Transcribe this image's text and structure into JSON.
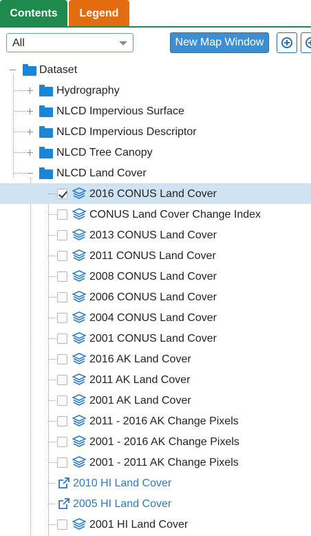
{
  "tabs": {
    "contents": "Contents",
    "legend": "Legend"
  },
  "toolbar": {
    "filter_value": "All",
    "new_map_window": "New Map Window"
  },
  "tree": {
    "root": "Dataset",
    "folders": [
      {
        "label": "Hydrography",
        "state": "collapsed"
      },
      {
        "label": "NLCD Impervious Surface",
        "state": "collapsed"
      },
      {
        "label": "NLCD Impervious Descriptor",
        "state": "collapsed"
      },
      {
        "label": "NLCD Tree Canopy",
        "state": "collapsed"
      },
      {
        "label": "NLCD Land Cover",
        "state": "expanded"
      }
    ],
    "land_cover_items": [
      {
        "label": "2016 CONUS Land Cover",
        "type": "layer",
        "checked": true,
        "selected": true
      },
      {
        "label": "CONUS Land Cover Change Index",
        "type": "layer",
        "checked": false
      },
      {
        "label": "2013 CONUS Land Cover",
        "type": "layer",
        "checked": false
      },
      {
        "label": "2011 CONUS Land Cover",
        "type": "layer",
        "checked": false
      },
      {
        "label": "2008 CONUS Land Cover",
        "type": "layer",
        "checked": false
      },
      {
        "label": "2006 CONUS Land Cover",
        "type": "layer",
        "checked": false
      },
      {
        "label": "2004 CONUS Land Cover",
        "type": "layer",
        "checked": false
      },
      {
        "label": "2001 CONUS Land Cover",
        "type": "layer",
        "checked": false
      },
      {
        "label": "2016 AK Land Cover",
        "type": "layer",
        "checked": false
      },
      {
        "label": "2011 AK Land Cover",
        "type": "layer",
        "checked": false
      },
      {
        "label": "2001 AK Land Cover",
        "type": "layer",
        "checked": false
      },
      {
        "label": "2011 - 2016 AK Change Pixels",
        "type": "layer",
        "checked": false
      },
      {
        "label": "2001 - 2016 AK Change Pixels",
        "type": "layer",
        "checked": false
      },
      {
        "label": "2001 - 2011 AK Change Pixels",
        "type": "layer",
        "checked": false
      },
      {
        "label": "2010 HI Land Cover",
        "type": "link"
      },
      {
        "label": "2005 HI Land Cover",
        "type": "link"
      },
      {
        "label": "2001 HI Land Cover",
        "type": "layer",
        "checked": false
      }
    ]
  },
  "colors": {
    "contents_tab": "#1e8a4c",
    "legend_tab": "#e26c0f",
    "accent": "#3d8fd1",
    "folder": "#1a86d6",
    "selected_row": "#cfe3f3",
    "link": "#2f78c4"
  },
  "icons": {
    "folder": "folder-icon",
    "layer": "layers-icon",
    "external": "external-link-icon",
    "zoom": "zoom-in-icon"
  }
}
